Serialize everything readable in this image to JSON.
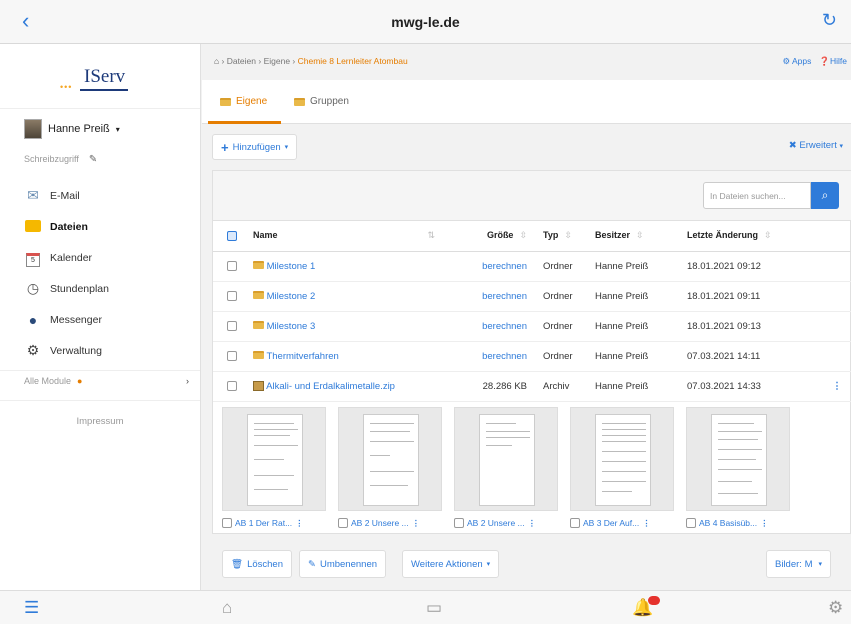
{
  "window": {
    "title": "mwg-le.de"
  },
  "sidebar": {
    "logo_text": "IServ",
    "user_name": "Hanne Preiß",
    "write_access": "Schreibzugriff",
    "items": [
      {
        "label": "E-Mail",
        "icon": "mail-icon"
      },
      {
        "label": "Dateien",
        "icon": "folder-icon",
        "active": true
      },
      {
        "label": "Kalender",
        "icon": "calendar-icon"
      },
      {
        "label": "Stundenplan",
        "icon": "clock-icon"
      },
      {
        "label": "Messenger",
        "icon": "chat-bubbles-icon"
      },
      {
        "label": "Verwaltung",
        "icon": "gear-icon"
      }
    ],
    "all_modules": "Alle Module",
    "imprint": "Impressum"
  },
  "breadcrumb": {
    "items": [
      "Dateien",
      "Eigene"
    ],
    "current": "Chemie 8 Lernleiter Atombau"
  },
  "top_links": {
    "apps": "Apps",
    "help": "Hilfe"
  },
  "tabs": [
    {
      "label": "Eigene",
      "active": true
    },
    {
      "label": "Gruppen",
      "active": false
    }
  ],
  "toolbar": {
    "add_label": "Hinzufügen",
    "advanced_label": "Erweitert"
  },
  "search": {
    "placeholder": "In Dateien suchen..."
  },
  "table": {
    "headers": {
      "name": "Name",
      "size": "Größe",
      "type": "Typ",
      "owner": "Besitzer",
      "modified": "Letzte Änderung"
    },
    "rows": [
      {
        "name": "Milestone 1",
        "size": "berechnen",
        "type": "Ordner",
        "owner": "Hanne Preiß",
        "modified": "18.01.2021 09:12"
      },
      {
        "name": "Milestone 2",
        "size": "berechnen",
        "type": "Ordner",
        "owner": "Hanne Preiß",
        "modified": "18.01.2021 09:11"
      },
      {
        "name": "Milestone 3",
        "size": "berechnen",
        "type": "Ordner",
        "owner": "Hanne Preiß",
        "modified": "18.01.2021 09:13"
      },
      {
        "name": "Thermitverfahren",
        "size": "berechnen",
        "type": "Ordner",
        "owner": "Hanne Preiß",
        "modified": "07.03.2021 14:11"
      },
      {
        "name": "Alkali- und Erdalkalimetalle.zip",
        "size": "28.286 KB",
        "type": "Archiv",
        "owner": "Hanne Preiß",
        "modified": "07.03.2021 14:33"
      }
    ]
  },
  "thumbnails": [
    {
      "name": "AB 1 Der Rat..."
    },
    {
      "name": "AB 2 Unsere ..."
    },
    {
      "name": "AB 2 Unsere ..."
    },
    {
      "name": "AB 3 Der Auf..."
    },
    {
      "name": "AB 4 Basisüb..."
    }
  ],
  "actions": {
    "delete_label": "Löschen",
    "rename_label": "Umbenennen",
    "more_label": "Weitere Aktionen",
    "view_label": "Bilder: M"
  },
  "colors": {
    "accent": "#2f7bd9",
    "active_tab": "#e57d00",
    "badge": "#e5322d"
  }
}
